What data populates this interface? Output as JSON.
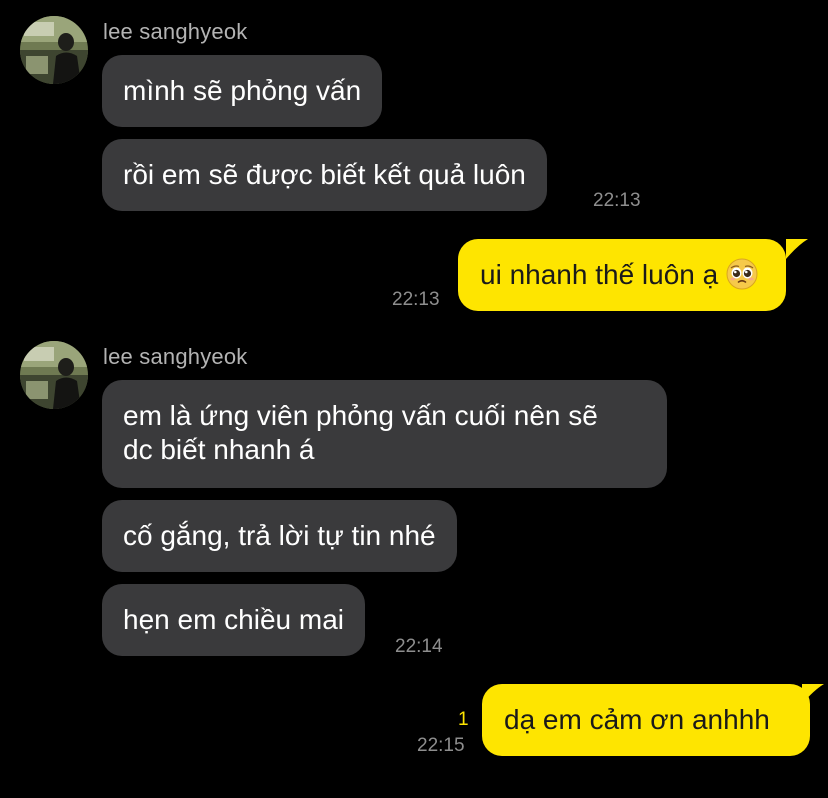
{
  "thread": {
    "groups": [
      {
        "sender": "lee sanghyeok",
        "messages": [
          "mình sẽ phỏng vấn",
          "rồi em sẽ được biết kết quả luôn"
        ],
        "time": "22:13"
      },
      {
        "sender": "lee sanghyeok",
        "messages": [
          "em là ứng viên phỏng vấn cuối nên sẽ",
          "dc biết nhanh á",
          "cố gắng, trả lời tự tin nhé",
          "hẹn em chiều mai"
        ],
        "time": "22:14"
      }
    ],
    "outgoing": [
      {
        "text": "ui nhanh thế luôn ạ",
        "emoji": "pleading-face-emoji",
        "time": "22:13"
      },
      {
        "text": "dạ em cảm ơn anhhh",
        "time": "22:15",
        "unread_count": "1"
      }
    ]
  },
  "colors": {
    "background": "#000000",
    "incoming_bubble": "#3a3a3c",
    "outgoing_bubble": "#fee500",
    "sender_name": "#b3b3b3",
    "timestamp": "#8e8e8e",
    "unread_count": "#fee500"
  }
}
